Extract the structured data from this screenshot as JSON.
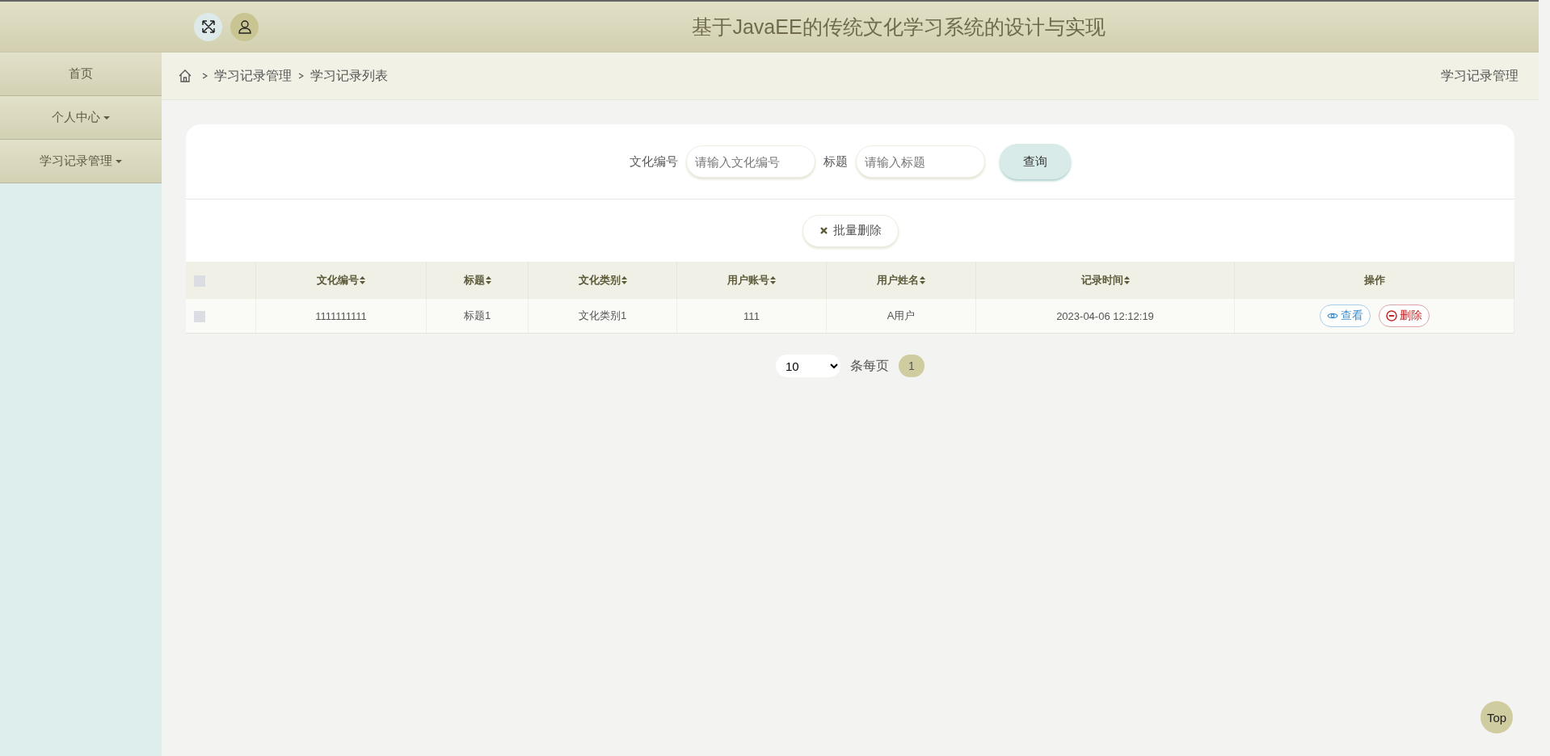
{
  "header": {
    "title": "基于JavaEE的传统文化学习系统的设计与实现"
  },
  "sidebar": {
    "items": [
      {
        "label": "首页",
        "has_menu": false
      },
      {
        "label": "个人中心",
        "has_menu": true
      },
      {
        "label": "学习记录管理",
        "has_menu": true
      }
    ]
  },
  "breadcrumb": {
    "items": [
      "学习记录管理",
      "学习记录列表"
    ],
    "page_title": "学习记录管理"
  },
  "search": {
    "fields": [
      {
        "label": "文化编号",
        "placeholder": "请输入文化编号"
      },
      {
        "label": "标题",
        "placeholder": "请输入标题"
      }
    ],
    "button": "查询"
  },
  "bulk_delete_button": "批量删除",
  "table": {
    "select_all_checked": false,
    "columns": [
      "文化编号",
      "标题",
      "文化类别",
      "用户账号",
      "用户姓名",
      "记录时间",
      "操作"
    ],
    "rows": [
      {
        "checked": false,
        "cells": [
          "1111111111",
          "标题1",
          "文化类别1",
          "111",
          "A用户",
          "2023-04-06 12:12:19"
        ],
        "actions": [
          "查看",
          "删除"
        ]
      }
    ]
  },
  "pagination": {
    "page_size": "10",
    "page_size_label": "条每页",
    "pages": [
      {
        "label": "1",
        "selected": true
      }
    ]
  },
  "top_button": "Top"
}
